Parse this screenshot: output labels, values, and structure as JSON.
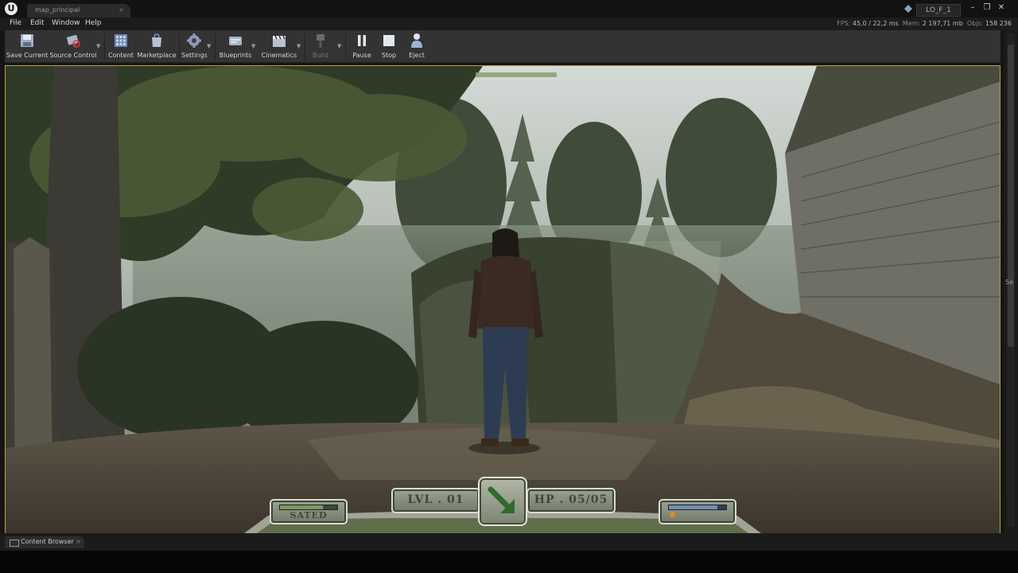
{
  "window": {
    "tab_title": "map_principal",
    "project_name": "LO_F_1",
    "controls": [
      "–",
      "❐",
      "✕"
    ]
  },
  "menu": [
    "File",
    "Edit",
    "Window",
    "Help"
  ],
  "stats": {
    "fps_label": "FPS:",
    "fps_value": "45,0 / 22,2 ms",
    "mem_label": "Mem:",
    "mem_value": "2 197,71 mb",
    "objs_label": "Objs:",
    "objs_value": "158 236"
  },
  "toolbar": {
    "save_current": "Save Current",
    "source_control": "Source Control",
    "content": "Content",
    "marketplace": "Marketplace",
    "settings": "Settings",
    "blueprints": "Blueprints",
    "cinematics": "Cinematics",
    "build": "Build",
    "pause": "Pause",
    "stop": "Stop",
    "eject": "Eject"
  },
  "side_strip_text": "Se",
  "hud": {
    "hunger_status": "SATED",
    "level": "LVL . 01",
    "hp": "HP . 05/05",
    "hunger_level": 0.75,
    "stamina_level": 0.85,
    "compass_icon": "arrow-down-right-icon"
  },
  "bottom": {
    "content_browser_tab": "Content Browser"
  },
  "colors": {
    "viewport_border": "#b8a040",
    "hud_text": "#3e4637",
    "hud_bar": "#7b9a62"
  }
}
